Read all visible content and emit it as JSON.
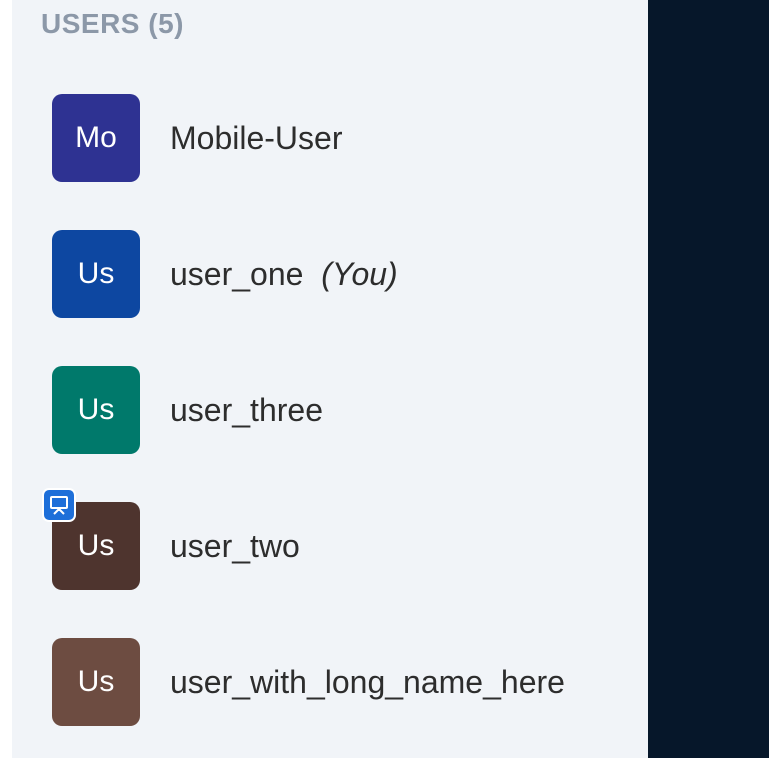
{
  "users_header": "USERS (5)",
  "you_label": "(You)",
  "users": [
    {
      "initials": "Mo",
      "name": "Mobile-User",
      "color": "#2e3292",
      "is_you": false,
      "presenter": false
    },
    {
      "initials": "Us",
      "name": "user_one",
      "color": "#0d47a1",
      "is_you": true,
      "presenter": false
    },
    {
      "initials": "Us",
      "name": "user_three",
      "color": "#00796b",
      "is_you": false,
      "presenter": false
    },
    {
      "initials": "Us",
      "name": "user_two",
      "color": "#4e342e",
      "is_you": false,
      "presenter": true
    },
    {
      "initials": "Us",
      "name": "user_with_long_name_here",
      "color": "#6d4c41",
      "is_you": false,
      "presenter": false
    }
  ],
  "presenter_icon": "presentation-board-icon"
}
